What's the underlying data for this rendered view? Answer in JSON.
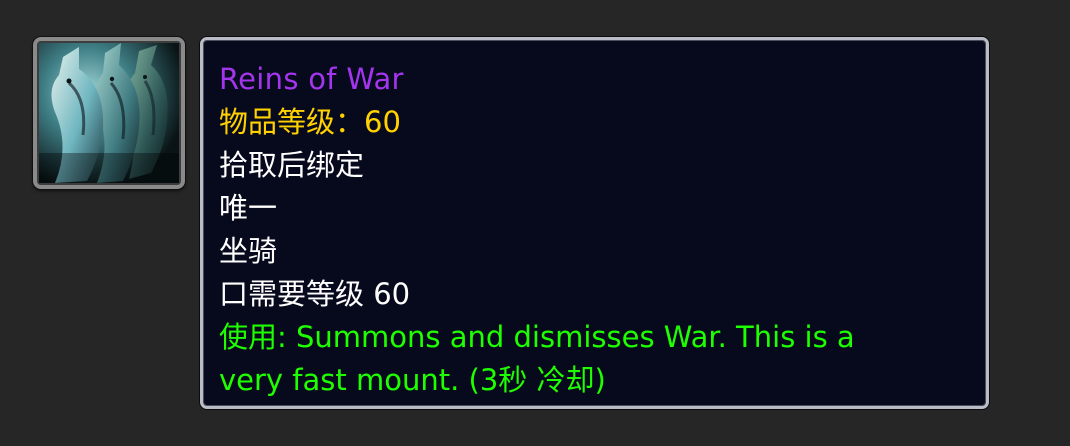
{
  "icon": {
    "name": "horse-mount-icon"
  },
  "tooltip": {
    "title": "Reins of War",
    "item_level": "物品等级：60",
    "binding": "拾取后绑定",
    "unique": "唯一",
    "item_type": "坐骑",
    "requirement": "口需要等级 60",
    "use_line_1": "使用: Summons and dismisses War.  This is a",
    "use_line_2": "very fast mount. (3秒 冷却)"
  },
  "colors": {
    "title": "#a335ee",
    "item_level": "#ffd100",
    "use_effect": "#1eff00",
    "tooltip_bg": "#070a1c",
    "page_bg": "#262626"
  }
}
